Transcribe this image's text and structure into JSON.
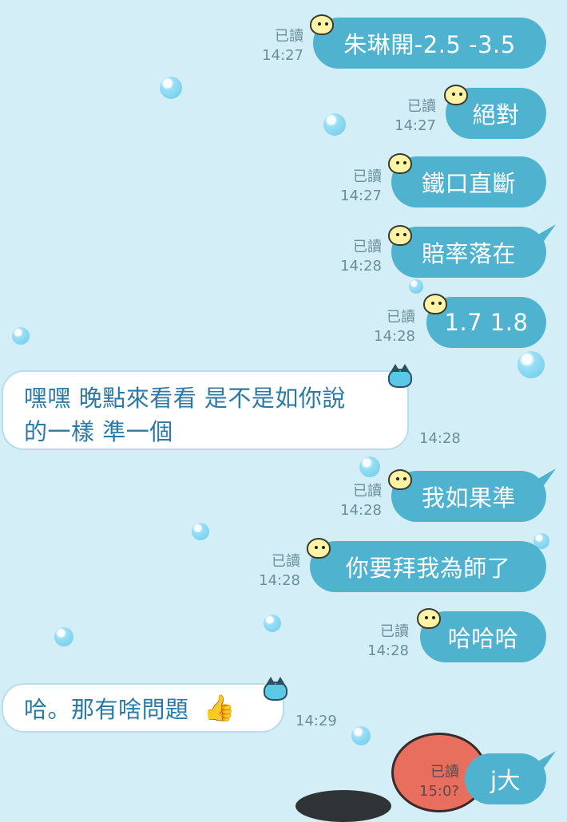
{
  "colors": {
    "background": "#d4eef7",
    "outgoing": "#4fb3cf",
    "incoming": "#ffffff",
    "incoming_text": "#2d79a6",
    "meta_text": "#6a8f9c"
  },
  "messages": [
    {
      "dir": "out",
      "text": "朱琳開-2.5 -3.5",
      "read": "已讀",
      "time": "14:27"
    },
    {
      "dir": "out",
      "text": "絕對",
      "read": "已讀",
      "time": "14:27"
    },
    {
      "dir": "out",
      "text": "鐵口直斷",
      "read": "已讀",
      "time": "14:27"
    },
    {
      "dir": "out",
      "text": "賠率落在",
      "read": "已讀",
      "time": "14:28"
    },
    {
      "dir": "out",
      "text": "1.7 1.8",
      "read": "已讀",
      "time": "14:28"
    },
    {
      "dir": "in",
      "line1": "嘿嘿 晚點來看看 是不是如你說",
      "line2": "的一樣 準一個",
      "time": "14:28"
    },
    {
      "dir": "out",
      "text": "我如果準",
      "read": "已讀",
      "time": "14:28"
    },
    {
      "dir": "out",
      "text": "你要拜我為師了",
      "read": "已讀",
      "time": "14:28"
    },
    {
      "dir": "out",
      "text": "哈哈哈",
      "read": "已讀",
      "time": "14:28"
    },
    {
      "dir": "in",
      "text": "哈。那有啥問題",
      "emoji": "👍",
      "time": "14:29"
    },
    {
      "dir": "out",
      "text": "j大",
      "read": "已讀",
      "time": "15:0?"
    }
  ]
}
